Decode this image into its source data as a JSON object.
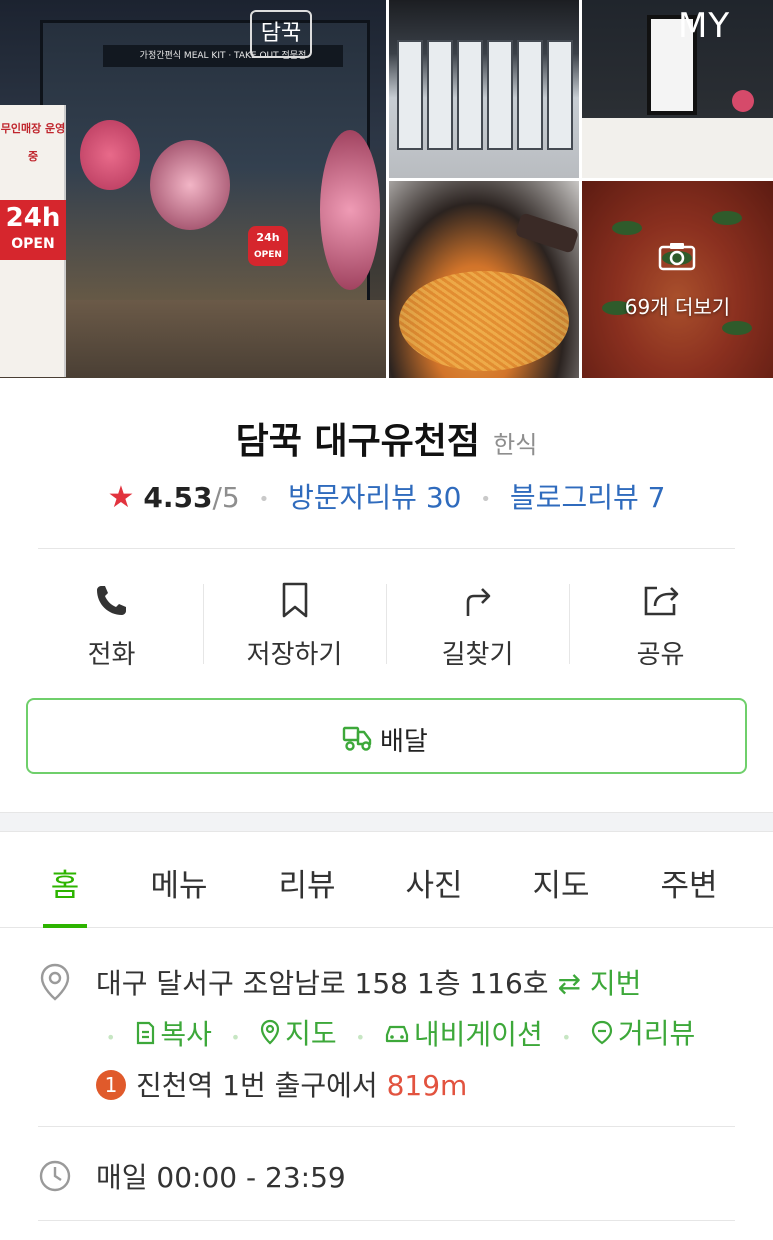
{
  "header": {
    "my_label": "MY"
  },
  "gallery": {
    "more_photos_label": "69개 더보기",
    "storefront": {
      "sign_text": "가정간편식 MEAL KIT · TAKE OUT 전문점",
      "logo_text": "담꾹",
      "banner_text": "무인매장 운영중",
      "banner_24h": "24h",
      "banner_open": "OPEN",
      "sticker_24h": "24h",
      "sticker_open": "OPEN"
    }
  },
  "place": {
    "name": "담꾹 대구유천점",
    "category": "한식",
    "rating": "4.53",
    "rating_max": "/5",
    "visitor_reviews": "방문자리뷰 30",
    "blog_reviews": "블로그리뷰 7"
  },
  "actions": [
    {
      "label": "전화",
      "icon": "phone-icon"
    },
    {
      "label": "저장하기",
      "icon": "bookmark-icon"
    },
    {
      "label": "길찾기",
      "icon": "directions-icon"
    },
    {
      "label": "공유",
      "icon": "share-icon"
    }
  ],
  "delivery": {
    "label": "배달",
    "icon": "delivery-scooter-icon"
  },
  "tabs": [
    {
      "label": "홈",
      "active": true
    },
    {
      "label": "메뉴",
      "active": false
    },
    {
      "label": "리뷰",
      "active": false
    },
    {
      "label": "사진",
      "active": false
    },
    {
      "label": "지도",
      "active": false
    },
    {
      "label": "주변",
      "active": false
    }
  ],
  "info": {
    "address": "대구 달서구 조암남로 158 1층 116호",
    "lot_toggle": "지번",
    "copy": "복사",
    "map": "지도",
    "navigation": "내비게이션",
    "street_view": "거리뷰",
    "station_number": "1",
    "station_text": "진천역 1번 출구에서",
    "station_distance": "819m",
    "hours": "매일 00:00 - 23:59"
  },
  "colors": {
    "accent_green": "#2db400",
    "link_blue": "#2f6bbd",
    "star_red": "#e2333e",
    "distance_red": "#e2533f",
    "station_badge": "#e05a2b"
  }
}
